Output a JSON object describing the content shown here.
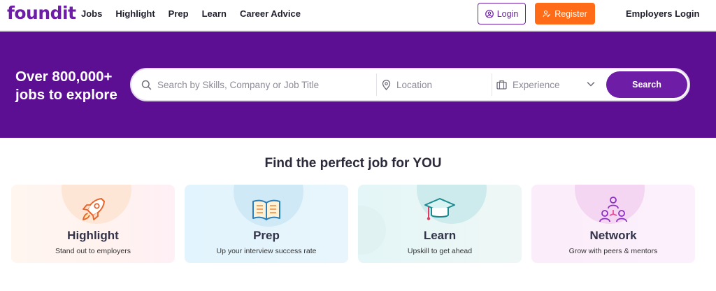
{
  "nav": {
    "logo": "foundit",
    "links": [
      "Jobs",
      "Highlight",
      "Prep",
      "Learn",
      "Career Advice"
    ],
    "login_label": "Login",
    "register_label": "Register",
    "employers_label": "Employers Login"
  },
  "hero": {
    "title_line1": "Over 800,000+",
    "title_line2": "jobs to explore",
    "search": {
      "skills_placeholder": "Search by Skills, Company or Job Title",
      "location_placeholder": "Location",
      "experience_placeholder": "Experience",
      "button_label": "Search"
    }
  },
  "section": {
    "title": "Find the perfect job for YOU",
    "cards": [
      {
        "title": "Highlight",
        "subtitle": "Stand out to employers",
        "icon": "rocket-icon"
      },
      {
        "title": "Prep",
        "subtitle": "Up your interview success rate",
        "icon": "book-icon"
      },
      {
        "title": "Learn",
        "subtitle": "Upskill to get ahead",
        "icon": "graduation-cap-icon"
      },
      {
        "title": "Network",
        "subtitle": "Grow with peers & mentors",
        "icon": "network-icon"
      }
    ]
  },
  "colors": {
    "brand_purple": "#6e1ea6",
    "hero_bg": "#5c0f92",
    "register_orange": "#ff6b17"
  }
}
